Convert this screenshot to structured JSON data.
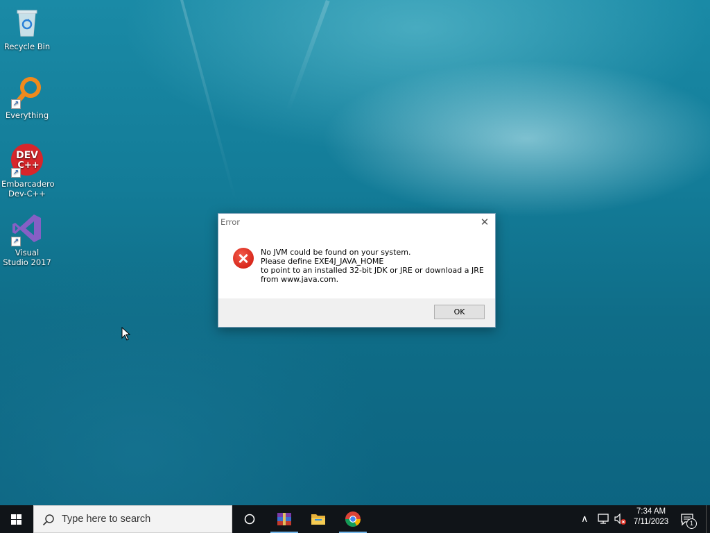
{
  "desktop": {
    "icons": [
      {
        "label": "Recycle Bin",
        "icon": "recycle-bin-icon"
      },
      {
        "label": "Everything",
        "icon": "everything-search-icon"
      },
      {
        "label": "Embarcadero Dev-C++",
        "icon": "devcpp-icon",
        "badge": "DEV C++"
      },
      {
        "label": "Visual Studio 2017",
        "icon": "visual-studio-icon"
      }
    ]
  },
  "dialog": {
    "title": "Error",
    "close_glyph": "✕",
    "message_lines": [
      "No JVM could be found on your system.",
      "Please define EXE4J_JAVA_HOME",
      "to point to an installed 32-bit JDK or JRE or download a JRE",
      "from www.java.com."
    ],
    "ok_label": "OK"
  },
  "taskbar": {
    "search_placeholder": "Type here to search",
    "apps": [
      "task-view-icon",
      "winrar-icon",
      "file-explorer-icon",
      "chrome-icon"
    ],
    "tray": {
      "time": "7:34 AM",
      "date": "7/11/2023",
      "notification_count": "1"
    }
  },
  "colors": {
    "error_red": "#d8281c",
    "taskbar_bg": "#101418",
    "accent_underline": "#76b9ed"
  }
}
